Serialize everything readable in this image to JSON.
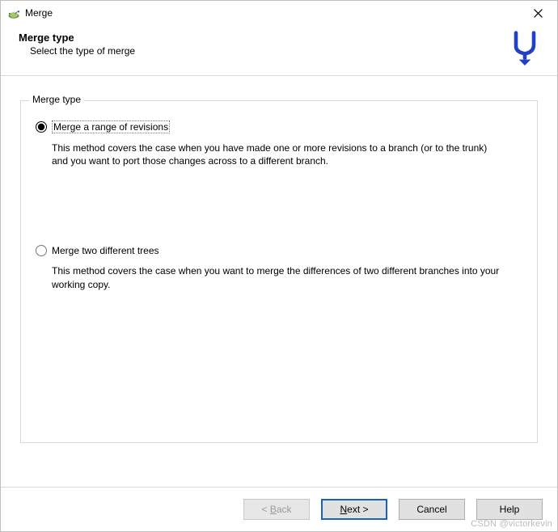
{
  "window": {
    "title": "Merge"
  },
  "header": {
    "title": "Merge type",
    "subtitle": "Select the type of merge"
  },
  "group": {
    "legend": "Merge type",
    "options": [
      {
        "label": "Merge a range of revisions",
        "selected": true,
        "description": "This method covers the case when you have made one or more revisions to a branch (or to the trunk) and you want to port those changes across to a different branch."
      },
      {
        "label": "Merge two different trees",
        "selected": false,
        "description": "This method covers the case when you want to merge the differences of two different branches into your working copy."
      }
    ]
  },
  "buttons": {
    "back": "< Back",
    "next": "Next >",
    "cancel": "Cancel",
    "help": "Help"
  },
  "watermark": "CSDN @victorkevin"
}
